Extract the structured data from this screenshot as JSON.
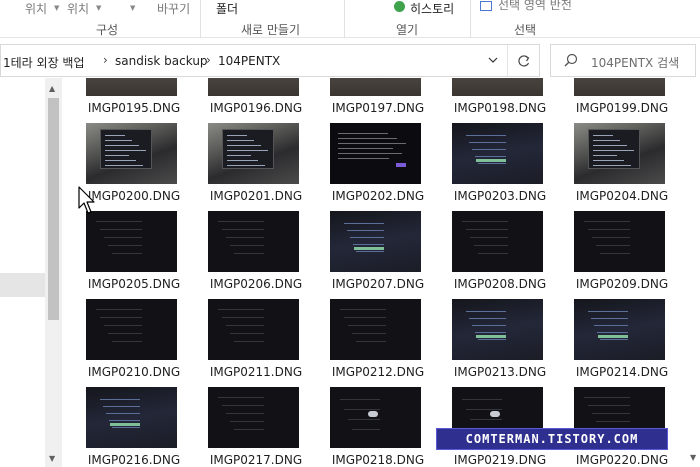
{
  "ribbon": {
    "item_location_1": "위치",
    "item_location_2": "위치",
    "item_paste": "바꾸기",
    "item_folder": "폴더",
    "item_history": "히스토리",
    "item_select_top": "선택 영역 반전",
    "group_organize": "구성",
    "group_new": "새로 만들기",
    "group_open": "열기",
    "group_select": "선택"
  },
  "address": {
    "crumbs": [
      "1테라 외장 백업",
      "sandisk backup",
      "104PENTX"
    ]
  },
  "search": {
    "placeholder": "104PENTX 검색"
  },
  "files": [
    {
      "name": "IMGP0195.DNG",
      "thumb": "top"
    },
    {
      "name": "IMGP0196.DNG",
      "thumb": "top"
    },
    {
      "name": "IMGP0197.DNG",
      "thumb": "top"
    },
    {
      "name": "IMGP0198.DNG",
      "thumb": "top"
    },
    {
      "name": "IMGP0199.DNG",
      "thumb": "top"
    },
    {
      "name": "IMGP0200.DNG",
      "thumb": "laptop"
    },
    {
      "name": "IMGP0201.DNG",
      "thumb": "laptop"
    },
    {
      "name": "IMGP0202.DNG",
      "thumb": "doc"
    },
    {
      "name": "IMGP0203.DNG",
      "thumb": "blue"
    },
    {
      "name": "IMGP0204.DNG",
      "thumb": "laptop"
    },
    {
      "name": "IMGP0205.DNG",
      "thumb": "dark"
    },
    {
      "name": "IMGP0206.DNG",
      "thumb": "dark"
    },
    {
      "name": "IMGP0207.DNG",
      "thumb": "blue"
    },
    {
      "name": "IMGP0208.DNG",
      "thumb": "dark"
    },
    {
      "name": "IMGP0209.DNG",
      "thumb": "dark"
    },
    {
      "name": "IMGP0210.DNG",
      "thumb": "dark"
    },
    {
      "name": "IMGP0211.DNG",
      "thumb": "dark"
    },
    {
      "name": "IMGP0212.DNG",
      "thumb": "dark"
    },
    {
      "name": "IMGP0213.DNG",
      "thumb": "blue"
    },
    {
      "name": "IMGP0214.DNG",
      "thumb": "blue"
    },
    {
      "name": "IMGP0216.DNG",
      "thumb": "blue"
    },
    {
      "name": "IMGP0217.DNG",
      "thumb": "dark"
    },
    {
      "name": "IMGP0218.DNG",
      "thumb": "cloud"
    },
    {
      "name": "IMGP0219.DNG",
      "thumb": "cloud"
    },
    {
      "name": "IMGP0220.DNG",
      "thumb": "dark"
    }
  ],
  "watermark": "COMTERMAN.TISTORY.COM",
  "colors": {
    "nav_selected": "#e5e5e5",
    "watermark_bg": "#2f2f8f",
    "scroll_thumb": "#c2c2c2"
  },
  "icons": {
    "addr_chevron": "chevron-right-icon",
    "refresh": "refresh-icon",
    "search": "search-icon",
    "history": "history-icon",
    "select": "select-icon"
  }
}
